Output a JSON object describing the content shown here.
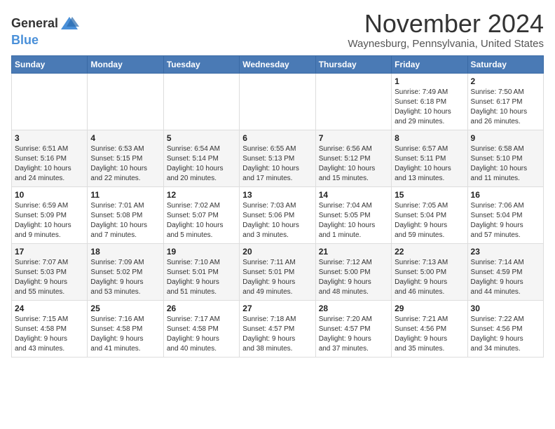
{
  "header": {
    "logo_line1": "General",
    "logo_line2": "Blue",
    "month_title": "November 2024",
    "location": "Waynesburg, Pennsylvania, United States"
  },
  "weekdays": [
    "Sunday",
    "Monday",
    "Tuesday",
    "Wednesday",
    "Thursday",
    "Friday",
    "Saturday"
  ],
  "weeks": [
    [
      {
        "day": "",
        "info": ""
      },
      {
        "day": "",
        "info": ""
      },
      {
        "day": "",
        "info": ""
      },
      {
        "day": "",
        "info": ""
      },
      {
        "day": "",
        "info": ""
      },
      {
        "day": "1",
        "info": "Sunrise: 7:49 AM\nSunset: 6:18 PM\nDaylight: 10 hours\nand 29 minutes."
      },
      {
        "day": "2",
        "info": "Sunrise: 7:50 AM\nSunset: 6:17 PM\nDaylight: 10 hours\nand 26 minutes."
      }
    ],
    [
      {
        "day": "3",
        "info": "Sunrise: 6:51 AM\nSunset: 5:16 PM\nDaylight: 10 hours\nand 24 minutes."
      },
      {
        "day": "4",
        "info": "Sunrise: 6:53 AM\nSunset: 5:15 PM\nDaylight: 10 hours\nand 22 minutes."
      },
      {
        "day": "5",
        "info": "Sunrise: 6:54 AM\nSunset: 5:14 PM\nDaylight: 10 hours\nand 20 minutes."
      },
      {
        "day": "6",
        "info": "Sunrise: 6:55 AM\nSunset: 5:13 PM\nDaylight: 10 hours\nand 17 minutes."
      },
      {
        "day": "7",
        "info": "Sunrise: 6:56 AM\nSunset: 5:12 PM\nDaylight: 10 hours\nand 15 minutes."
      },
      {
        "day": "8",
        "info": "Sunrise: 6:57 AM\nSunset: 5:11 PM\nDaylight: 10 hours\nand 13 minutes."
      },
      {
        "day": "9",
        "info": "Sunrise: 6:58 AM\nSunset: 5:10 PM\nDaylight: 10 hours\nand 11 minutes."
      }
    ],
    [
      {
        "day": "10",
        "info": "Sunrise: 6:59 AM\nSunset: 5:09 PM\nDaylight: 10 hours\nand 9 minutes."
      },
      {
        "day": "11",
        "info": "Sunrise: 7:01 AM\nSunset: 5:08 PM\nDaylight: 10 hours\nand 7 minutes."
      },
      {
        "day": "12",
        "info": "Sunrise: 7:02 AM\nSunset: 5:07 PM\nDaylight: 10 hours\nand 5 minutes."
      },
      {
        "day": "13",
        "info": "Sunrise: 7:03 AM\nSunset: 5:06 PM\nDaylight: 10 hours\nand 3 minutes."
      },
      {
        "day": "14",
        "info": "Sunrise: 7:04 AM\nSunset: 5:05 PM\nDaylight: 10 hours\nand 1 minute."
      },
      {
        "day": "15",
        "info": "Sunrise: 7:05 AM\nSunset: 5:04 PM\nDaylight: 9 hours\nand 59 minutes."
      },
      {
        "day": "16",
        "info": "Sunrise: 7:06 AM\nSunset: 5:04 PM\nDaylight: 9 hours\nand 57 minutes."
      }
    ],
    [
      {
        "day": "17",
        "info": "Sunrise: 7:07 AM\nSunset: 5:03 PM\nDaylight: 9 hours\nand 55 minutes."
      },
      {
        "day": "18",
        "info": "Sunrise: 7:09 AM\nSunset: 5:02 PM\nDaylight: 9 hours\nand 53 minutes."
      },
      {
        "day": "19",
        "info": "Sunrise: 7:10 AM\nSunset: 5:01 PM\nDaylight: 9 hours\nand 51 minutes."
      },
      {
        "day": "20",
        "info": "Sunrise: 7:11 AM\nSunset: 5:01 PM\nDaylight: 9 hours\nand 49 minutes."
      },
      {
        "day": "21",
        "info": "Sunrise: 7:12 AM\nSunset: 5:00 PM\nDaylight: 9 hours\nand 48 minutes."
      },
      {
        "day": "22",
        "info": "Sunrise: 7:13 AM\nSunset: 5:00 PM\nDaylight: 9 hours\nand 46 minutes."
      },
      {
        "day": "23",
        "info": "Sunrise: 7:14 AM\nSunset: 4:59 PM\nDaylight: 9 hours\nand 44 minutes."
      }
    ],
    [
      {
        "day": "24",
        "info": "Sunrise: 7:15 AM\nSunset: 4:58 PM\nDaylight: 9 hours\nand 43 minutes."
      },
      {
        "day": "25",
        "info": "Sunrise: 7:16 AM\nSunset: 4:58 PM\nDaylight: 9 hours\nand 41 minutes."
      },
      {
        "day": "26",
        "info": "Sunrise: 7:17 AM\nSunset: 4:58 PM\nDaylight: 9 hours\nand 40 minutes."
      },
      {
        "day": "27",
        "info": "Sunrise: 7:18 AM\nSunset: 4:57 PM\nDaylight: 9 hours\nand 38 minutes."
      },
      {
        "day": "28",
        "info": "Sunrise: 7:20 AM\nSunset: 4:57 PM\nDaylight: 9 hours\nand 37 minutes."
      },
      {
        "day": "29",
        "info": "Sunrise: 7:21 AM\nSunset: 4:56 PM\nDaylight: 9 hours\nand 35 minutes."
      },
      {
        "day": "30",
        "info": "Sunrise: 7:22 AM\nSunset: 4:56 PM\nDaylight: 9 hours\nand 34 minutes."
      }
    ]
  ]
}
